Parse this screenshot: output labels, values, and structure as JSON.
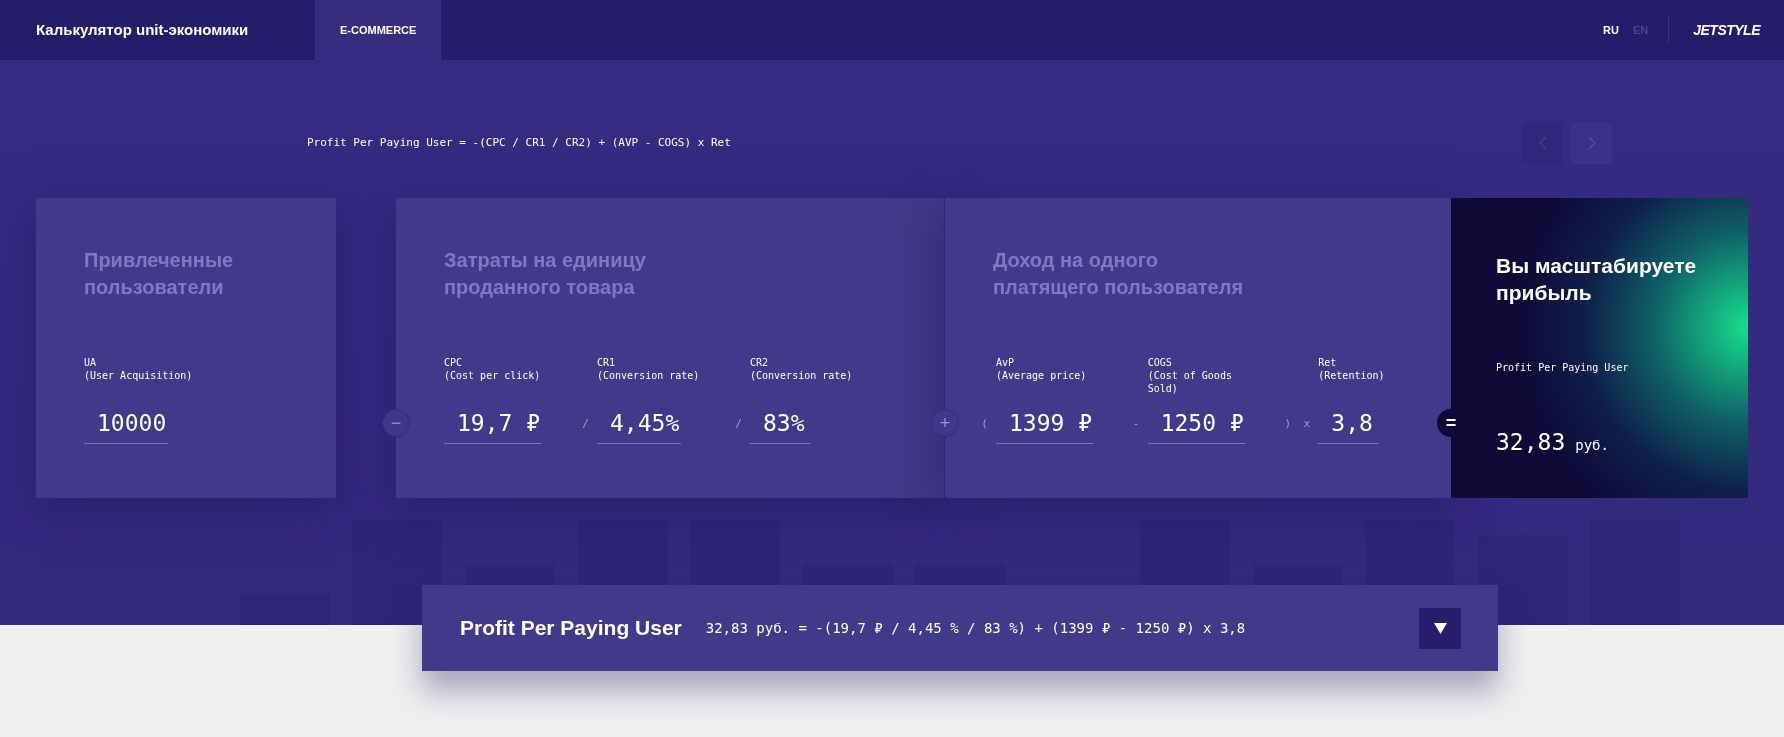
{
  "header": {
    "title": "Калькулятор unit-экономики",
    "tabs": [
      {
        "label": "E-COMMERCE",
        "selected": true
      }
    ],
    "languages": [
      {
        "label": "RU",
        "selected": true
      },
      {
        "label": "EN",
        "selected": false
      }
    ],
    "logo": "JETSTYLE"
  },
  "formula": "Profit Per Paying User = -(CPC / CR1 / CR2) + (AVP - COGS) x Ret",
  "cards": [
    {
      "title": "Привлеченные пользователи",
      "items": [
        {
          "kind": "field",
          "code": "UA",
          "description": "(User Acquisition)",
          "value": "10000"
        }
      ]
    },
    {
      "joiner": "−",
      "title": "Затраты на единицу проданного товара",
      "items": [
        {
          "kind": "field",
          "code": "CPC",
          "description": "(Cost per click)",
          "value": "19,7 ₽"
        },
        {
          "kind": "operator",
          "symbol": "/"
        },
        {
          "kind": "field",
          "code": "CR1",
          "description": "(Conversion rate)",
          "value": "4,45%"
        },
        {
          "kind": "operator",
          "symbol": "/"
        },
        {
          "kind": "field",
          "code": "CR2",
          "description": "(Conversion rate)",
          "value": "83%"
        }
      ]
    },
    {
      "joiner": "+",
      "title": "Доход на одного платящего пользователя",
      "items": [
        {
          "kind": "operator",
          "symbol": "("
        },
        {
          "kind": "field",
          "code": "AvP",
          "description": "(Average price)",
          "value": "1399 ₽"
        },
        {
          "kind": "operator",
          "symbol": "-"
        },
        {
          "kind": "field",
          "code": "COGS",
          "description": "(Cost of Goods Sold)",
          "value": "1250 ₽"
        },
        {
          "kind": "operator",
          "symbol": ")"
        },
        {
          "kind": "operator",
          "symbol": "x"
        },
        {
          "kind": "field",
          "code": "Ret",
          "description": "(Retention)",
          "value": "3,8"
        }
      ]
    }
  ],
  "result": {
    "joiner": "=",
    "title": "Вы масштабируете прибыль",
    "label": "Profit Per Paying User",
    "value": "32,83",
    "unit": "руб."
  },
  "summary": {
    "title": "Profit Per Paying User",
    "formula": "32,83 руб. = -(19,7 ₽ / 4,45 % / 83 %) + (1399 ₽ - 1250 ₽) x 3,8",
    "expanded": false
  }
}
